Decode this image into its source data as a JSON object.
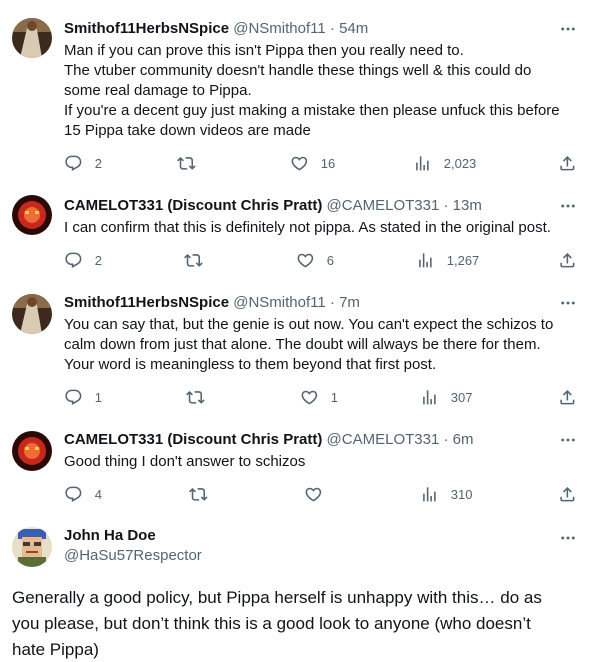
{
  "replies": [
    {
      "name": "Smithof11HerbsNSpice",
      "handle": "@NSmithof11",
      "time": "54m",
      "lines": [
        "Man if you can prove this isn't Pippa then you really need to.",
        "The vtuber community doesn't handle these things well & this could do",
        "some real damage to Pippa.",
        "If you're a decent guy just making a mistake then please unfuck this before",
        "15 Pippa take down videos are made"
      ],
      "replies": "2",
      "reposts": "",
      "likes": "16",
      "views": "2,023"
    },
    {
      "name": "CAMELOT331 (Discount Chris Pratt)",
      "handle": "@CAMELOT331",
      "time": "13m",
      "lines": [
        "I can confirm that this is definitely not pippa. As stated in the original post."
      ],
      "replies": "2",
      "reposts": "",
      "likes": "6",
      "views": "1,267"
    },
    {
      "name": "Smithof11HerbsNSpice",
      "handle": "@NSmithof11",
      "time": "7m",
      "lines": [
        "You can say that, but the genie is out now. You can't expect the schizos to",
        "calm down from just that alone. The doubt will always be there for them.",
        "Your word is meaningless to them beyond that first post."
      ],
      "replies": "1",
      "reposts": "",
      "likes": "1",
      "views": "307"
    },
    {
      "name": "CAMELOT331 (Discount Chris Pratt)",
      "handle": "@CAMELOT331",
      "time": "6m",
      "lines": [
        "Good thing I don't answer to schizos"
      ],
      "replies": "4",
      "reposts": "",
      "likes": "",
      "views": "310"
    }
  ],
  "focused": {
    "name": "John Ha Doe",
    "handle": "@HaSu57Respector",
    "lines": [
      "Generally a good policy, but Pippa herself is unhappy with this… do as",
      "you please, but don’t think this is a good look to anyone (who doesn’t",
      "hate Pippa)"
    ]
  },
  "separator": " · ",
  "icons": {
    "reply": "reply-icon",
    "repost": "repost-icon",
    "like": "like-icon",
    "views": "views-icon",
    "share": "share-icon",
    "more": "more-icon"
  },
  "colors": {
    "text": "#0f1419",
    "secondary": "#536471",
    "thread_line": "#cfd9de",
    "background": "#ffffff"
  }
}
